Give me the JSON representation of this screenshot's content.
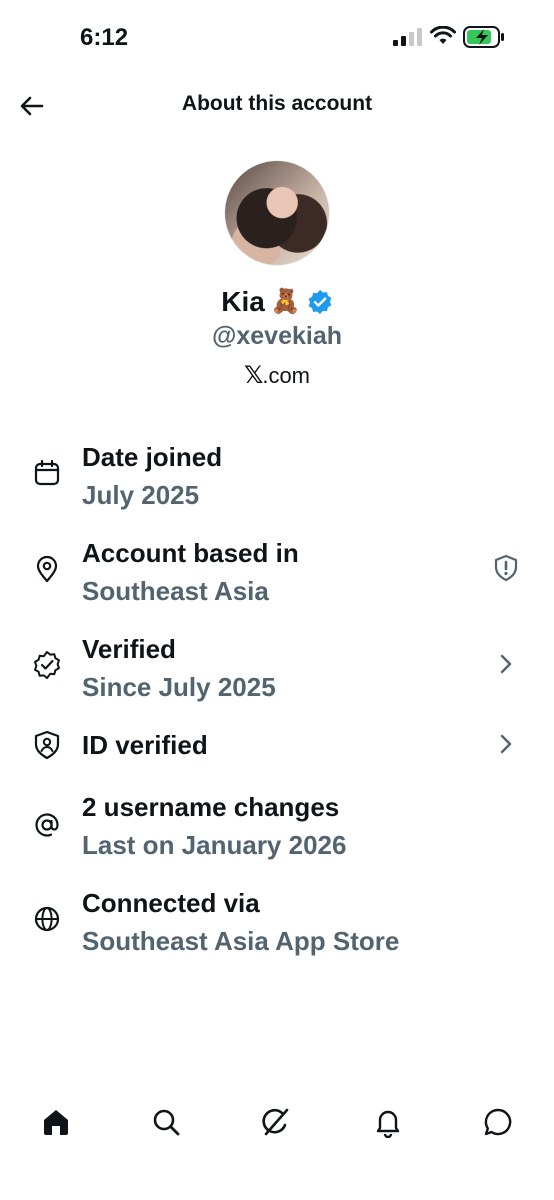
{
  "status_bar": {
    "time": "6:12",
    "icons": [
      "cellular-signal-icon",
      "wifi-icon",
      "battery-charging-icon"
    ]
  },
  "header": {
    "back_icon": "arrow-left-icon",
    "title": "About this account"
  },
  "profile": {
    "display_name": "Kia",
    "name_emoji": "🧸",
    "verified_badge_color": "#1d9bf0",
    "handle": "@xevekiah",
    "platform_mark": "𝕏",
    "platform_suffix": ".com"
  },
  "details": [
    {
      "icon": "calendar-icon",
      "title": "Date joined",
      "value": "July 2025"
    },
    {
      "icon": "location-pin-icon",
      "title": "Account based in",
      "value": "Southeast Asia",
      "trailing_icon": "shield-alert-icon"
    },
    {
      "icon": "verified-check-icon",
      "title": "Verified",
      "value": "Since July 2025",
      "trailing_icon": "chevron-right-icon"
    },
    {
      "icon": "id-shield-icon",
      "title": "ID verified",
      "trailing_icon": "chevron-right-icon"
    },
    {
      "icon": "at-sign-icon",
      "title": "2 username changes",
      "value": "Last on January 2026"
    },
    {
      "icon": "globe-icon",
      "title": "Connected via",
      "value": "Southeast Asia App Store"
    }
  ],
  "tab_bar": {
    "tabs": [
      "home-icon",
      "search-icon",
      "grok-icon",
      "notifications-bell-icon",
      "messages-icon"
    ]
  },
  "colors": {
    "text_primary": "#0f1419",
    "text_secondary": "#536471",
    "accent": "#1d9bf0",
    "battery_green": "#34c759"
  }
}
